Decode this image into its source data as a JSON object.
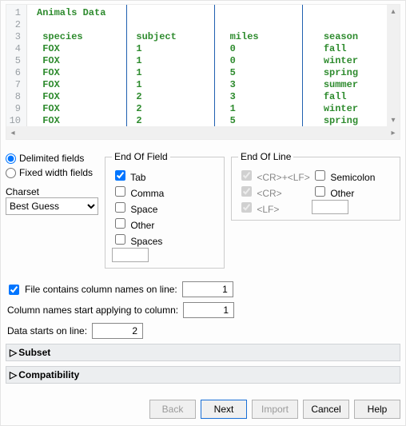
{
  "preview": {
    "title": "Animals Data",
    "columns": [
      "species",
      "subject",
      "miles",
      "season"
    ],
    "rows": [
      [
        "FOX",
        "1",
        "0",
        "fall"
      ],
      [
        "FOX",
        "1",
        "0",
        "winter"
      ],
      [
        "FOX",
        "1",
        "5",
        "spring"
      ],
      [
        "FOX",
        "1",
        "3",
        "summer"
      ],
      [
        "FOX",
        "2",
        "3",
        "fall"
      ],
      [
        "FOX",
        "2",
        "1",
        "winter"
      ],
      [
        "FOX",
        "2",
        "5",
        "spring"
      ]
    ],
    "line_start": 1
  },
  "fieldmode": {
    "delimited": "Delimited fields",
    "fixed": "Fixed width fields"
  },
  "charset": {
    "label": "Charset",
    "value": "Best Guess"
  },
  "eof": {
    "legend": "End Of Field",
    "tab": "Tab",
    "comma": "Comma",
    "space": "Space",
    "other": "Other",
    "spaces": "Spaces",
    "otherval": ""
  },
  "eol": {
    "legend": "End Of Line",
    "crlf": "<CR>+<LF>",
    "semicolon": "Semicolon",
    "cr": "<CR>",
    "other": "Other",
    "lf": "<LF>",
    "otherval": ""
  },
  "lines": {
    "colnames_label": "File contains column names on line:",
    "colnames_value": "1",
    "applycol_label": "Column names start applying to column:",
    "applycol_value": "1",
    "datastart_label": "Data starts on line:",
    "datastart_value": "2"
  },
  "sections": {
    "subset": "Subset",
    "compat": "Compatibility"
  },
  "buttons": {
    "back": "Back",
    "next": "Next",
    "import": "Import",
    "cancel": "Cancel",
    "help": "Help"
  }
}
